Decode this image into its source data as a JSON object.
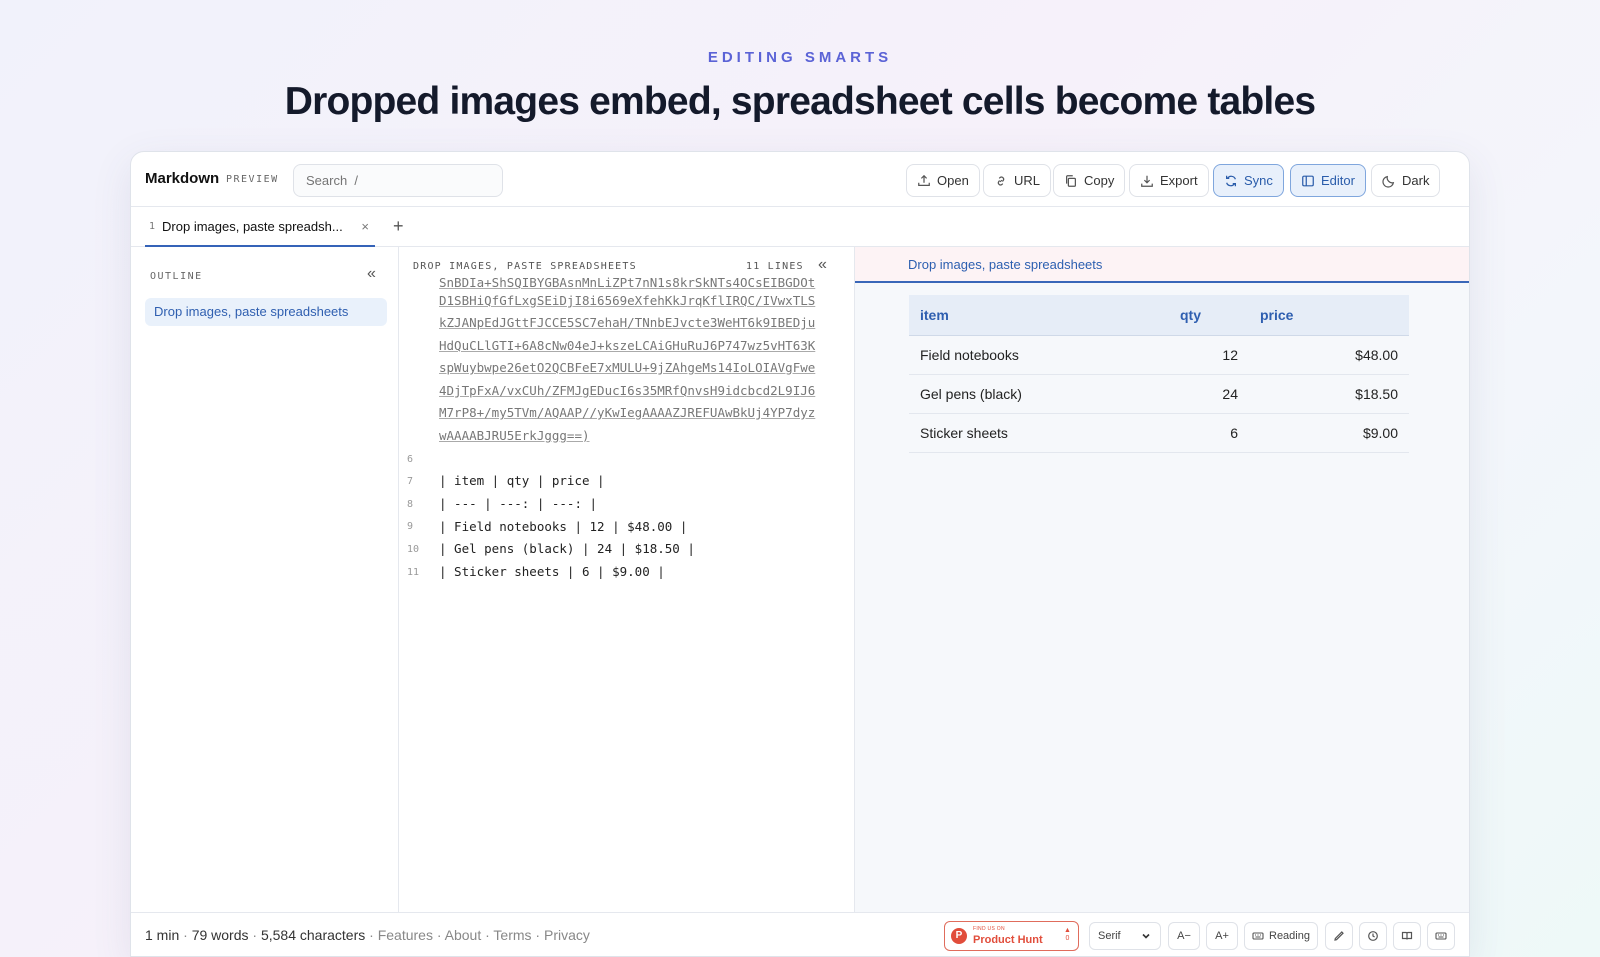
{
  "hero": {
    "eyebrow": "EDITING SMARTS",
    "headline": "Dropped images embed, spreadsheet cells become tables"
  },
  "toolbar": {
    "brand": "Markdown",
    "brand_sub": "PREVIEW",
    "search_placeholder": "Search  /",
    "buttons": {
      "open": "Open",
      "url": "URL",
      "copy": "Copy",
      "export": "Export",
      "sync": "Sync",
      "editor": "Editor",
      "dark": "Dark"
    }
  },
  "tabs": {
    "active": {
      "number": "1",
      "label": "Drop images, paste spreadsh...",
      "close": "×"
    },
    "add": "+"
  },
  "outline": {
    "label": "OUTLINE",
    "collapse": "«",
    "items": [
      "Drop images, paste spreadsheets"
    ]
  },
  "editor": {
    "title": "DROP IMAGES, PASTE SPREADSHEETS",
    "lines_count": "11 LINES",
    "collapse": "«",
    "clipped_line": "SnBDIa+ShSQIBYGBAsnMnLiZPt7nN1s8krSkNTs4OCsEIBGDOt",
    "base64_lines": [
      "D1SBHiQfGfLxgSEiDjI8i6569eXfehKkJrqKflIRQC/IVwxTLS",
      "kZJANpEdJGttFJCCE5SC7ehaH/TNnbEJvcte3WeHT6k9IBEDju",
      "HdQuCLlGTI+6A8cNw04eJ+kszeLCAiGHuRuJ6P747wz5vHT63K",
      "spWuybwpe26etO2QCBFeE7xMULU+9jZAhgeMs14IoLOIAVgFwe",
      "4DjTpFxA/vxCUh/ZFMJgEDucI6s35MRfQnvsH9idcbcd2L9IJ6",
      "M7rP8+/my5TVm/AQAAP//yKwIegAAAAZJREFUAwBkUj4YP7dyz",
      "wAAAABJRU5ErkJggg==)"
    ],
    "lines": [
      {
        "n": "6",
        "text": ""
      },
      {
        "n": "7",
        "text": "| item | qty | price |"
      },
      {
        "n": "8",
        "text": "| --- | ---: | ---: |"
      },
      {
        "n": "9",
        "text": "| Field notebooks | 12 | $48.00 |"
      },
      {
        "n": "10",
        "text": "| Gel pens (black) | 24 | $18.50 |"
      },
      {
        "n": "11",
        "text": "| Sticker sheets | 6 | $9.00 |"
      }
    ]
  },
  "preview": {
    "title": "Drop images, paste spreadsheets",
    "table": {
      "headers": [
        "item",
        "qty",
        "price"
      ],
      "rows": [
        [
          "Field notebooks",
          "12",
          "$48.00"
        ],
        [
          "Gel pens (black)",
          "24",
          "$18.50"
        ],
        [
          "Sticker sheets",
          "6",
          "$9.00"
        ]
      ]
    }
  },
  "status": {
    "read_time": "1 min",
    "words": "79 words",
    "characters": "5,584 characters",
    "links": [
      "Features",
      "About",
      "Terms",
      "Privacy"
    ],
    "product_hunt_small": "FIND US ON",
    "product_hunt": "Product Hunt",
    "product_hunt_votes": "0",
    "font_select": "Serif",
    "font_smaller": "A−",
    "font_larger": "A+",
    "reading": "Reading"
  },
  "colors": {
    "accent": "#3563b8",
    "eyebrow": "#5b63d6",
    "product_hunt": "#e14d3b"
  }
}
